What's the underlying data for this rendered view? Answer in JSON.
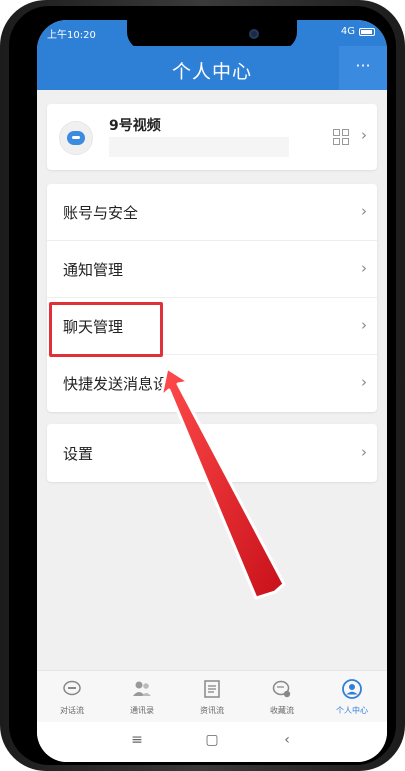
{
  "status_bar": {
    "time": "上午10:20",
    "network": "4G"
  },
  "header": {
    "title": "个人中心",
    "more_label": "···"
  },
  "profile": {
    "name": "9号视频",
    "chevron": "›"
  },
  "menu": {
    "items": [
      {
        "label": "账号与安全",
        "chevron": "›"
      },
      {
        "label": "通知管理",
        "chevron": "›"
      },
      {
        "label": "聊天管理",
        "chevron": "›"
      },
      {
        "label": "快捷发送消息设置",
        "chevron": "›"
      }
    ]
  },
  "settings": {
    "label": "设置",
    "chevron": "›"
  },
  "tabs": [
    {
      "label": "对话流",
      "icon": "chat-bubble-icon",
      "active": false
    },
    {
      "label": "通讯录",
      "icon": "contacts-icon",
      "active": false
    },
    {
      "label": "资讯流",
      "icon": "news-icon",
      "active": false
    },
    {
      "label": "收藏流",
      "icon": "favorites-icon",
      "active": false
    },
    {
      "label": "个人中心",
      "icon": "person-icon",
      "active": true
    }
  ],
  "nav": {
    "menu_glyph": "≡",
    "home_glyph": "▢",
    "back_glyph": "‹"
  },
  "colors": {
    "accent": "#2e7fd6",
    "highlight": "#e0303a"
  }
}
